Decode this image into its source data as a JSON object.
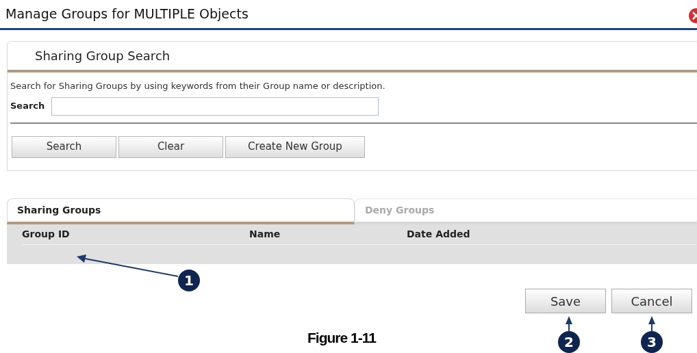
{
  "window": {
    "title": "Manage Groups for MULTIPLE Objects"
  },
  "search_panel": {
    "title": "Sharing Group Search",
    "description": "Search for Sharing Groups by using keywords from their Group name or description.",
    "search_label": "Search",
    "buttons": [
      "Search",
      "Clear",
      "Create New Group"
    ]
  },
  "tabs": [
    {
      "label": "Sharing Groups",
      "selected": true
    },
    {
      "label": "Deny Groups",
      "selected": false
    }
  ],
  "table": {
    "columns": [
      "Group ID",
      "Name",
      "Date Added"
    ]
  },
  "buttons": [
    "Save",
    "Cancel"
  ],
  "callouts": [
    "1",
    "2",
    "3"
  ],
  "caption": "Figure 1-11"
}
